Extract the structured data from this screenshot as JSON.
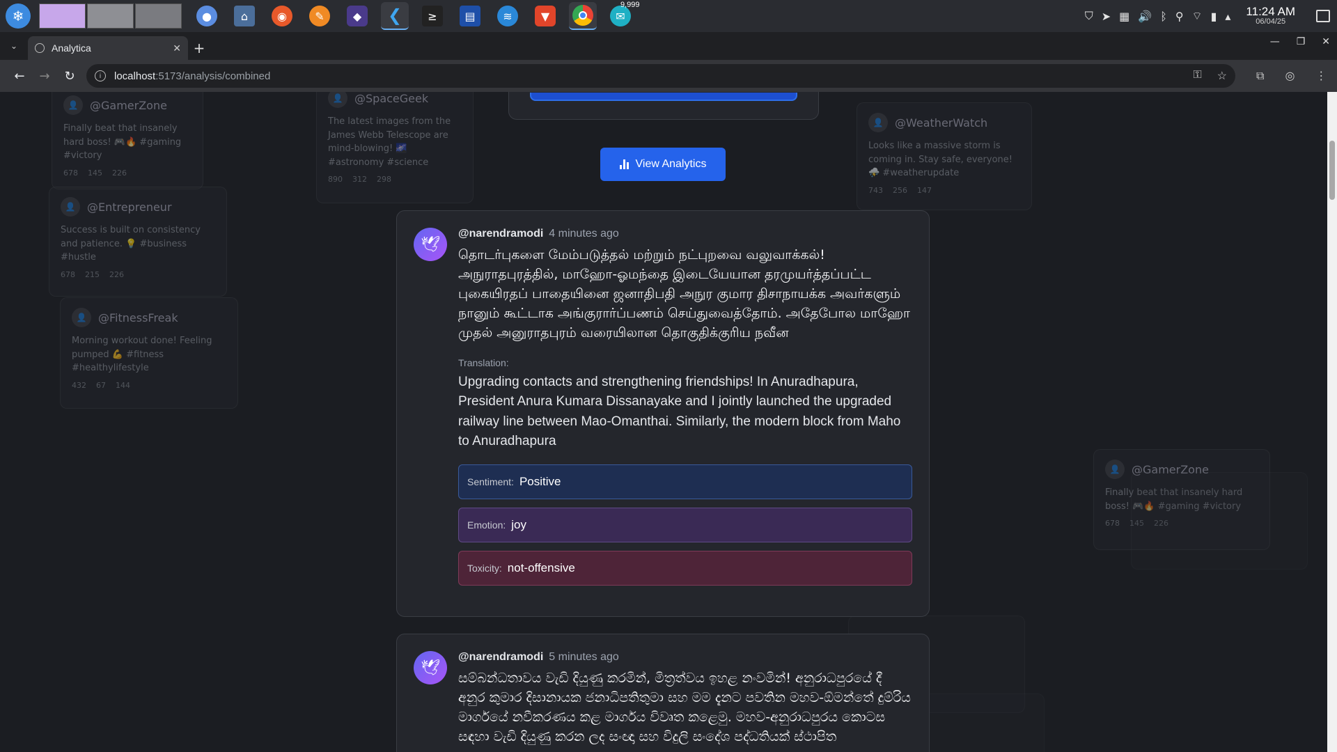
{
  "taskbar": {
    "badge_count": "9,999",
    "time": "11:24 AM",
    "date": "06/04/25"
  },
  "browser": {
    "tab_title": "Analytica",
    "url_host": "localhost",
    "url_path": ":5173/analysis/combined"
  },
  "page": {
    "view_analytics_label": "View Analytics",
    "background_cards": [
      {
        "handle": "@GamerZone",
        "text": "Finally beat that insanely hard boss! 🎮🔥 #gaming #victory",
        "likes": "678",
        "retweets": "145",
        "replies": "226"
      },
      {
        "handle": "@SpaceGeek",
        "text": "The latest images from the James Webb Telescope are mind-blowing! 🌌 #astronomy #science",
        "likes": "890",
        "retweets": "312",
        "replies": "298"
      },
      {
        "handle": "@WeatherWatch",
        "text": "Looks like a massive storm is coming in. Stay safe, everyone! ⛈️ #weatherupdate",
        "likes": "743",
        "retweets": "256",
        "replies": "147"
      },
      {
        "handle": "@Entrepreneur",
        "text": "Success is built on consistency and patience. 💡 #business #hustle",
        "likes": "678",
        "retweets": "215",
        "replies": "226"
      },
      {
        "handle": "@FitnessFreak",
        "text": "Morning workout done! Feeling pumped 💪 #fitness #healthylifestyle",
        "likes": "432",
        "retweets": "67",
        "replies": "144"
      },
      {
        "handle": "@GamerZone",
        "text": "Finally beat that insanely hard boss! 🎮🔥 #gaming #victory",
        "likes": "678",
        "retweets": "145",
        "replies": "226"
      }
    ],
    "posts": [
      {
        "handle": "@narendramodi",
        "time": "4 minutes ago",
        "text": "தொடர்புகளை மேம்படுத்தல் மற்றும் நட்புறவை வலுவாக்கல்! அநுராதபுரத்தில், மாஹோ-ஓமந்தை இடையேயான தரமுயர்த்தப்பட்ட புகையிரதப் பாதையினை ஜனாதிபதி அநுர குமார திசாநாயக்க அவர்களும் நானும் கூட்டாக அங்குரார்ப்பணம் செய்துவைத்தோம். அதேபோல மாஹோ முதல் அனுராதபுரம் வரையிலான தொகுதிக்குரிய நவீன",
        "translation_label": "Translation:",
        "translation": "Upgrading contacts and strengthening friendships! In Anuradhapura, President Anura Kumara Dissanayake and I jointly launched the upgraded railway line between Mao-Omanthai. Similarly, the modern block from Maho to Anuradhapura",
        "sentiment_label": "Sentiment:",
        "sentiment": "Positive",
        "emotion_label": "Emotion:",
        "emotion": "joy",
        "toxicity_label": "Toxicity:",
        "toxicity": "not-offensive"
      },
      {
        "handle": "@narendramodi",
        "time": "5 minutes ago",
        "text": "සම්බන්ධතාවය වැඩි දියුණු කරමින්, මිත්‍රත්වය ඉහළ නංවමින්! අනුරාධපුරයේ දී අනුර කුමාර දිසානායක ජනාධිපතිතුමා සහ මම දැනට පවතින මහව-ඕමන්තේ දුම්රිය මාර්ගයේ නවීකරණය කළ මාර්ගය විවෘත කළෙමු. මහව-අනුරාධපුරය කොටස සඳහා වැඩි දියුණු කරන ලද සංඥා සහ විදුලි සංදේශ පද්ධතියක් ස්ථාපිත"
      }
    ]
  }
}
